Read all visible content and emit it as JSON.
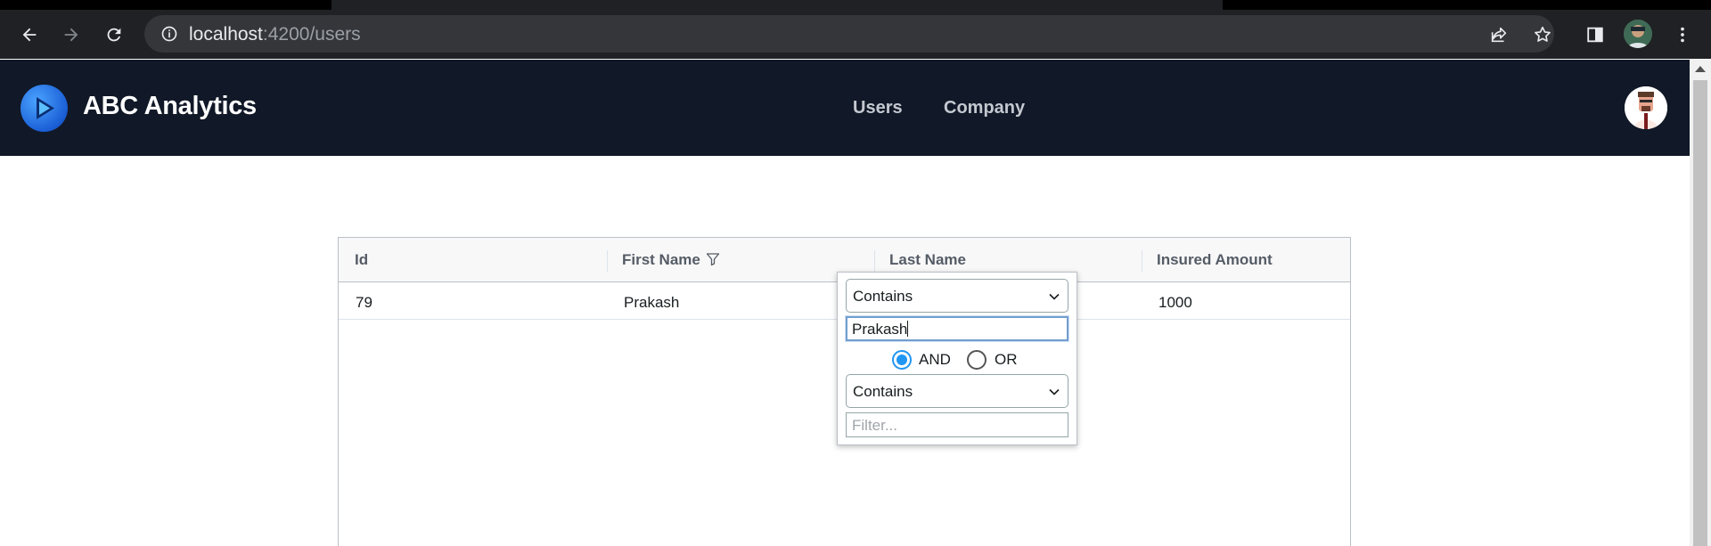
{
  "browser": {
    "url_host": "localhost",
    "url_path": ":4200/users",
    "icons": [
      "back-icon",
      "forward-icon",
      "reload-icon",
      "info-icon",
      "share-icon",
      "star-icon",
      "side-panel-icon",
      "profile-avatar",
      "menu-icon"
    ]
  },
  "app": {
    "brand": "ABC Analytics",
    "nav": {
      "users": "Users",
      "company": "Company"
    },
    "colors": {
      "nav_bg": "#111827",
      "accent": "#2196f3"
    }
  },
  "grid": {
    "columns": [
      "Id",
      "First Name",
      "Last Name",
      "Insured Amount"
    ],
    "rows": [
      [
        "79",
        "Prakash",
        "",
        "1000"
      ]
    ]
  },
  "filter": {
    "condition1": "Contains",
    "value1": "Prakash",
    "join_and": "AND",
    "join_or": "OR",
    "join_selected": "AND",
    "condition2": "Contains",
    "value2_placeholder": "Filter..."
  }
}
